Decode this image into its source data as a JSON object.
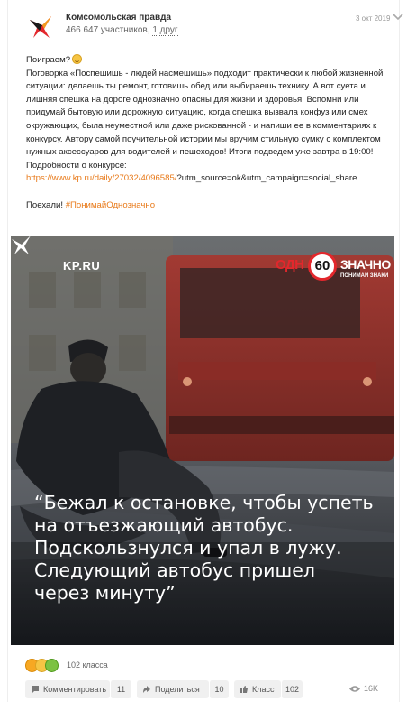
{
  "header": {
    "group_name": "Комсомольская правда",
    "members": "466 647 участников,",
    "friends": "1 друг",
    "date": "3 окт 2019"
  },
  "post": {
    "greeting": "Поиграем?",
    "body": "Поговорка «Поспешишь - людей насмешишь» подходит практически к любой жизненной ситуации: делаешь ты ремонт, готовишь обед или выбираешь технику. А вот суета и лишняя спешка на дороге однозначно опасны для жизни и здоровья. Вспомни или придумай бытовую или дорожную ситуацию, когда спешка вызвала конфуз или смех окружающих, была неуместной или даже рискованной -  и напиши ее в комментариях к конкурсу. Автору самой поучительной истории мы вручим стильную сумку с комплектом нужных аксессуаров для водителей и пешеходов! Итоги подведем уже завтра в 19:00! Подробности о конкурсе:",
    "link": "https://www.kp.ru/daily/27032/4096585/",
    "link_suffix": "?utm_source=ok&utm_campaign=social_share",
    "closing": "Поехали!",
    "hashtag": "#ПонимайОднозначно"
  },
  "image": {
    "kp_logo": "KP.RU",
    "brand_left": "ОДН",
    "brand_number": "60",
    "brand_right": "ЗНАЧНО",
    "brand_sub": "ПОНИМАЙ ЗНАКИ",
    "quote_lines": [
      "“Бежал к остановке, чтобы успеть",
      "на отъезжающий автобус.",
      "Подскользнулся и упал в лужу.",
      "Следующий автобус пришел",
      "через минуту”"
    ]
  },
  "reactions": {
    "count": "102 класса"
  },
  "actions": {
    "comment_label": "Комментировать",
    "comment_count": "11",
    "share_label": "Поделиться",
    "share_count": "10",
    "like_label": "Класс",
    "like_count": "102",
    "views": "16K"
  },
  "colors": {
    "accent": "#e87a1a",
    "brand_red": "#e3272c"
  }
}
